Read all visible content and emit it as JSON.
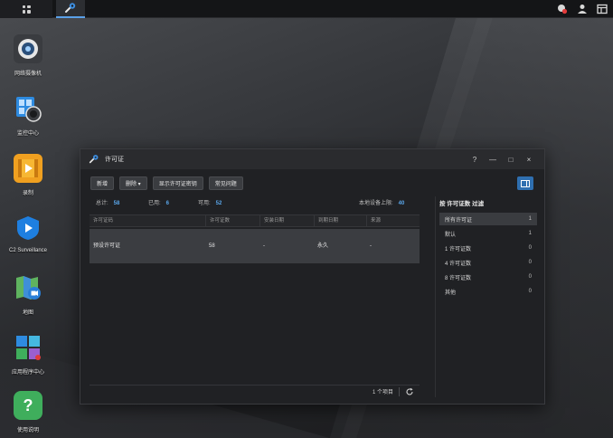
{
  "desktop": {
    "icons": [
      {
        "label": "网络摄像机",
        "icon": "camera-icon"
      },
      {
        "label": "监控中心",
        "icon": "monitor-center-icon"
      },
      {
        "label": "录制",
        "icon": "recording-icon"
      },
      {
        "label": "C2 Surveillance",
        "icon": "c2-surveillance-icon"
      },
      {
        "label": "地图",
        "icon": "map-icon"
      },
      {
        "label": "应用程序中心",
        "icon": "app-center-icon"
      },
      {
        "label": "使用说明",
        "icon": "help-icon"
      }
    ]
  },
  "taskbar": {
    "left": [
      "main-menu-icon",
      "license-app-icon"
    ],
    "right": [
      "notification-icon",
      "user-icon",
      "widgets-icon"
    ]
  },
  "window": {
    "title": "许可证",
    "controls": {
      "help": "?",
      "minimize": "—",
      "maximize": "□",
      "close": "×"
    },
    "toolbar": {
      "add": "新增",
      "delete": "删除 ▾",
      "show_keys": "显示许可证密钥",
      "faq": "常见问题"
    },
    "stats": {
      "total_label": "总计:",
      "total_value": "58",
      "used_label": "已用:",
      "used_value": "6",
      "available_label": "可用:",
      "available_value": "52",
      "limit_label": "本地设备上限:",
      "limit_value": "40"
    },
    "table": {
      "columns": [
        "许可证码",
        "许可证数",
        "安装日期",
        "到期日期",
        "来源"
      ],
      "rows": [
        {
          "code": "预设许可证",
          "count": "58",
          "install": "-",
          "expire": "永久",
          "source": "-"
        }
      ],
      "footer_count": "1 个项目",
      "refresh_icon": "refresh-icon"
    },
    "filter": {
      "title": "按 许可证数 过滤",
      "items": [
        {
          "label": "所有许可证",
          "count": "1"
        },
        {
          "label": "默认",
          "count": "1"
        },
        {
          "label": "1 许可证数",
          "count": "0"
        },
        {
          "label": "4 许可证数",
          "count": "0"
        },
        {
          "label": "8 许可证数",
          "count": "0"
        },
        {
          "label": "其他",
          "count": "0"
        }
      ]
    },
    "accent_color": "#2f6fb0",
    "value_color": "#5aa7ec"
  }
}
